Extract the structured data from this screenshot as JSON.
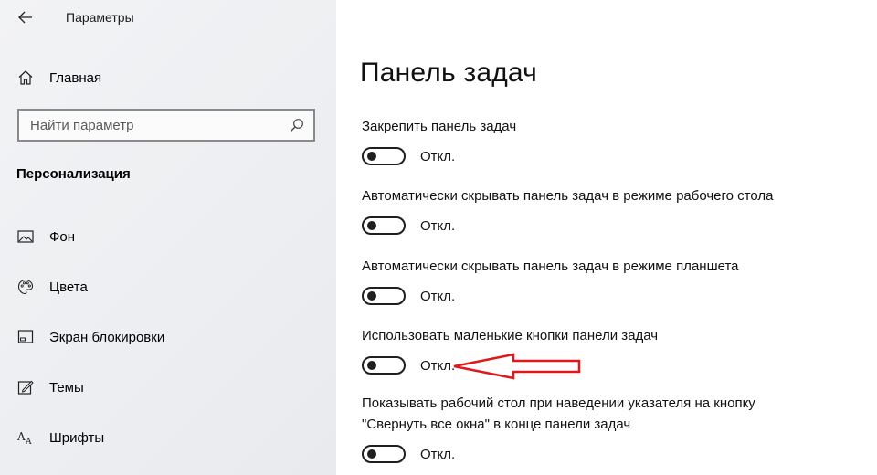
{
  "app": {
    "title": "Параметры"
  },
  "sidebar": {
    "home_label": "Главная",
    "search_placeholder": "Найти параметр",
    "section_title": "Персонализация",
    "items": [
      {
        "label": "Фон",
        "icon": "image-icon"
      },
      {
        "label": "Цвета",
        "icon": "palette-icon"
      },
      {
        "label": "Экран блокировки",
        "icon": "lock-screen-icon"
      },
      {
        "label": "Темы",
        "icon": "themes-icon"
      },
      {
        "label": "Шрифты",
        "icon": "fonts-icon"
      }
    ]
  },
  "main": {
    "page_title": "Панель задач",
    "settings": [
      {
        "label": "Закрепить панель задач",
        "state": "Откл.",
        "on": false
      },
      {
        "label": "Автоматически скрывать панель задач в режиме рабочего стола",
        "state": "Откл.",
        "on": false
      },
      {
        "label": "Автоматически скрывать панель задач в режиме планшета",
        "state": "Откл.",
        "on": false
      },
      {
        "label": "Использовать маленькие кнопки панели задач",
        "state": "Откл.",
        "on": false
      },
      {
        "label_line1": "Показывать рабочий стол при наведении указателя на кнопку",
        "label_line2": "\"Свернуть все окна\" в конце панели задач",
        "state": "Откл.",
        "on": false
      }
    ]
  },
  "annotation": {
    "arrow_color": "#e0181b"
  }
}
